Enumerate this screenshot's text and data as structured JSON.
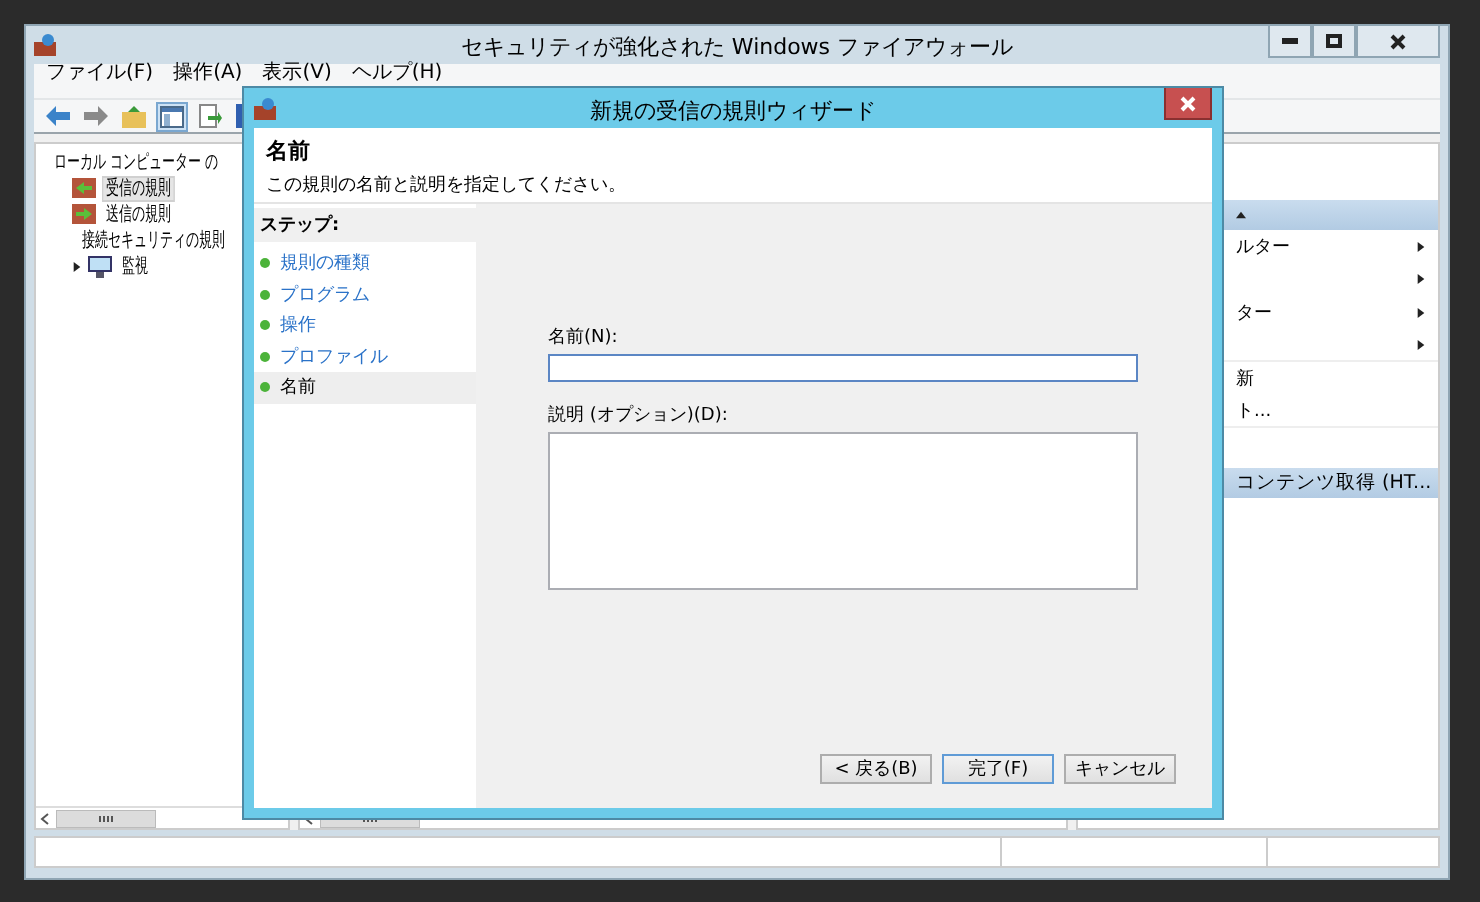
{
  "window": {
    "title": "セキュリティが強化された Windows ファイアウォール"
  },
  "menu": [
    "ファイル(F)",
    "操作(A)",
    "表示(V)",
    "ヘルプ(H)"
  ],
  "toolbar": [
    {
      "kind": "back"
    },
    {
      "kind": "forward"
    },
    {
      "kind": "up"
    },
    {
      "kind": "pane",
      "selected": true
    },
    {
      "kind": "export"
    },
    {
      "kind": "help"
    }
  ],
  "tree": [
    {
      "label": "ローカル コンピューター の",
      "kind": "root",
      "selected": false,
      "children": [
        {
          "label": "受信の規則",
          "kind": "inbound",
          "selected": true
        },
        {
          "label": "送信の規則",
          "kind": "outbound",
          "selected": false
        },
        {
          "label": "接続セキュリティの規則",
          "kind": "connection",
          "selected": false
        },
        {
          "label": "監視",
          "kind": "monitor",
          "selected": false,
          "expanded": false
        }
      ]
    }
  ],
  "actions": [
    {
      "expanded": true,
      "items": [
        {
          "label": "ルター",
          "submenu": true
        },
        {
          "submenu": true
        },
        {
          "label": "ター",
          "submenu": true
        },
        {
          "submenu": true
        },
        {
          "label": "新",
          "submenu": false
        },
        {
          "label": "ト...",
          "submenu": false
        }
      ]
    },
    {
      "title": "コンテンツ取得 (HT...",
      "expanded": true
    }
  ],
  "dialog": {
    "title": "新規の受信の規則ウィザード",
    "heading": "名前",
    "subtitle": "この規則の名前と説明を指定してください。",
    "steps_heading": "ステップ:",
    "steps": [
      {
        "label": "規則の種類",
        "selected": false
      },
      {
        "label": "プログラム",
        "selected": false
      },
      {
        "label": "操作",
        "selected": false
      },
      {
        "label": "プロファイル",
        "selected": false
      },
      {
        "label": "名前",
        "selected": true
      }
    ],
    "name_field": {
      "label": "名前(N):",
      "focused": true
    },
    "description_field": {
      "label": "説明 (オプション)(D):"
    },
    "buttons": [
      {
        "label": "< 戻る(B)",
        "default": false
      },
      {
        "label": "完了(F)",
        "default": true
      },
      {
        "label": "キャンセル",
        "default": false
      }
    ]
  }
}
